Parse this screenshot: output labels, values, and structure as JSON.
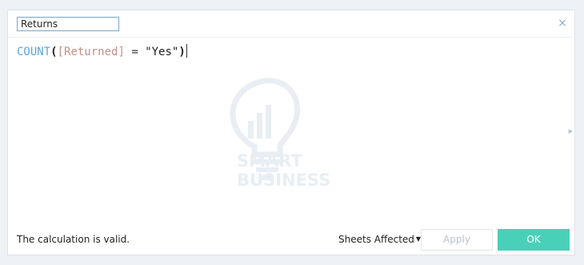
{
  "dialog": {
    "name_field_value": "Returns",
    "close_glyph": "×",
    "formula": {
      "function": "COUNT",
      "open_paren": "(",
      "field": "[Returned]",
      "operator": " = ",
      "string": "\"Yes\"",
      "close_paren": ")"
    },
    "watermark_text": "SMART BUSINESS",
    "status_text": "The calculation is valid.",
    "sheets_affected_label": "Sheets Affected",
    "apply_label": "Apply",
    "ok_label": "OK"
  },
  "colors": {
    "accent": "#48d1b8",
    "function": "#5aa6dc",
    "field": "#c0928a"
  },
  "icons": {
    "close": "close-icon",
    "dropdown": "chevron-down-icon",
    "side": "side-arrow-icon"
  }
}
